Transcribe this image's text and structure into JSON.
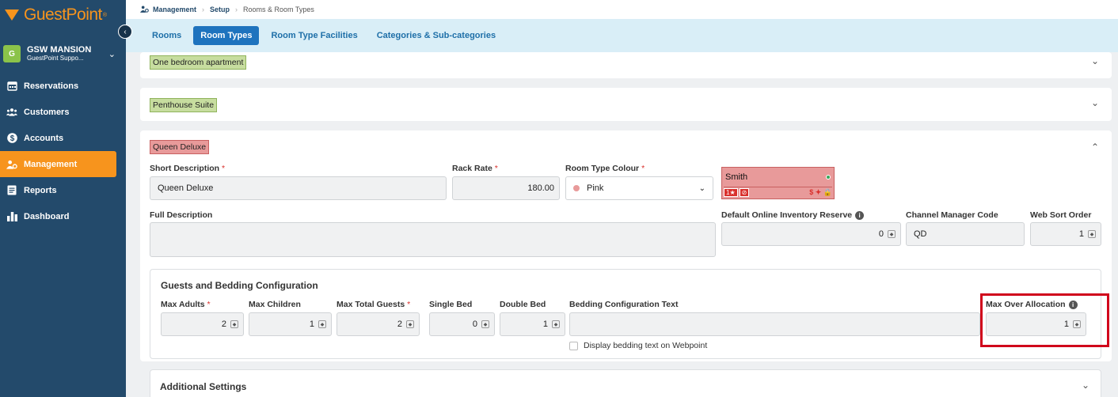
{
  "app": {
    "logo_text": "GuestPoint",
    "logo_tm": "®",
    "property_initial": "G",
    "property_name": "GSW MANSION",
    "property_sub": "GuestPoint Suppo..."
  },
  "sidebar": {
    "items": [
      {
        "label": "Reservations",
        "icon": "calendar-icon"
      },
      {
        "label": "Customers",
        "icon": "users-icon"
      },
      {
        "label": "Accounts",
        "icon": "dollar-icon"
      },
      {
        "label": "Management",
        "icon": "management-icon",
        "active": true
      },
      {
        "label": "Reports",
        "icon": "report-icon"
      },
      {
        "label": "Dashboard",
        "icon": "chart-icon"
      }
    ]
  },
  "breadcrumb": {
    "items": [
      "Management",
      "Setup",
      "Rooms & Room Types"
    ]
  },
  "tabs": [
    "Rooms",
    "Room Types",
    "Room Type Facilities",
    "Categories & Sub-categories"
  ],
  "active_tab": "Room Types",
  "room_types": [
    {
      "name": "One bedroom apartment",
      "color": "#c7dd9f",
      "collapsed": true
    },
    {
      "name": "Penthouse Suite",
      "color": "#c7dd9f",
      "collapsed": true
    }
  ],
  "expanded": {
    "name": "Queen Deluxe",
    "chip_color": "#e89a9a",
    "short_desc_label": "Short Description",
    "short_desc_value": "Queen Deluxe",
    "rack_rate_label": "Rack Rate",
    "rack_rate_value": "180.00",
    "colour_label": "Room Type Colour",
    "colour_value": "Pink",
    "preview": {
      "name": "Smith",
      "badge1": "1★",
      "badge2": "⊘",
      "icons": "$ ✦ 🔒"
    },
    "full_desc_label": "Full Description",
    "inventory_label": "Default Online Inventory Reserve",
    "inventory_value": "0",
    "channel_label": "Channel Manager Code",
    "channel_value": "QD",
    "sort_label": "Web Sort Order",
    "sort_value": "1",
    "req": "*"
  },
  "bedding": {
    "title": "Guests and Bedding Configuration",
    "max_adults_label": "Max Adults",
    "max_adults": "2",
    "max_children_label": "Max Children",
    "max_children": "1",
    "max_total_label": "Max Total Guests",
    "max_total": "2",
    "single_label": "Single Bed",
    "single": "0",
    "double_label": "Double Bed",
    "double": "1",
    "text_label": "Bedding Configuration Text",
    "text_value": "",
    "checkbox_label": "Display bedding text on Webpoint",
    "over_alloc_label": "Max Over Allocation",
    "over_alloc": "1"
  },
  "additional": {
    "title": "Additional Settings"
  }
}
